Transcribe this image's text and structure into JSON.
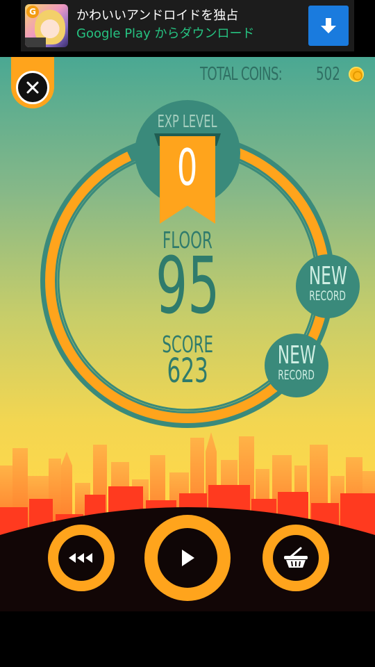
{
  "ad": {
    "title": "かわいいアンドロイドを独占",
    "subtitle": "Google Play からダウンロード",
    "icon": "anime-girl-app-icon",
    "download_icon": "download-arrow-icon"
  },
  "header": {
    "coins_label": "TOTAL COINS:",
    "coins_value": "502",
    "coin_icon": "coin-icon"
  },
  "stats": {
    "exp_label": "EXP LEVEL",
    "exp_value": "0",
    "floor_label": "FLOOR",
    "floor_value": "95",
    "score_label": "SCORE",
    "score_value": "623"
  },
  "badges": [
    {
      "line1": "NEW",
      "line2": "RECORD"
    },
    {
      "line1": "NEW",
      "line2": "RECORD"
    }
  ],
  "controls": {
    "close_icon": "close-icon",
    "rewind_icon": "rewind-icon",
    "play_icon": "play-icon",
    "shop_icon": "shopping-basket-icon"
  },
  "progress": {
    "ring_fill_fraction": 0.93
  },
  "colors": {
    "accent": "#ffa41c",
    "ring_bg": "#3a8a7b",
    "text": "#2f7b6c",
    "ground": "#120606"
  }
}
